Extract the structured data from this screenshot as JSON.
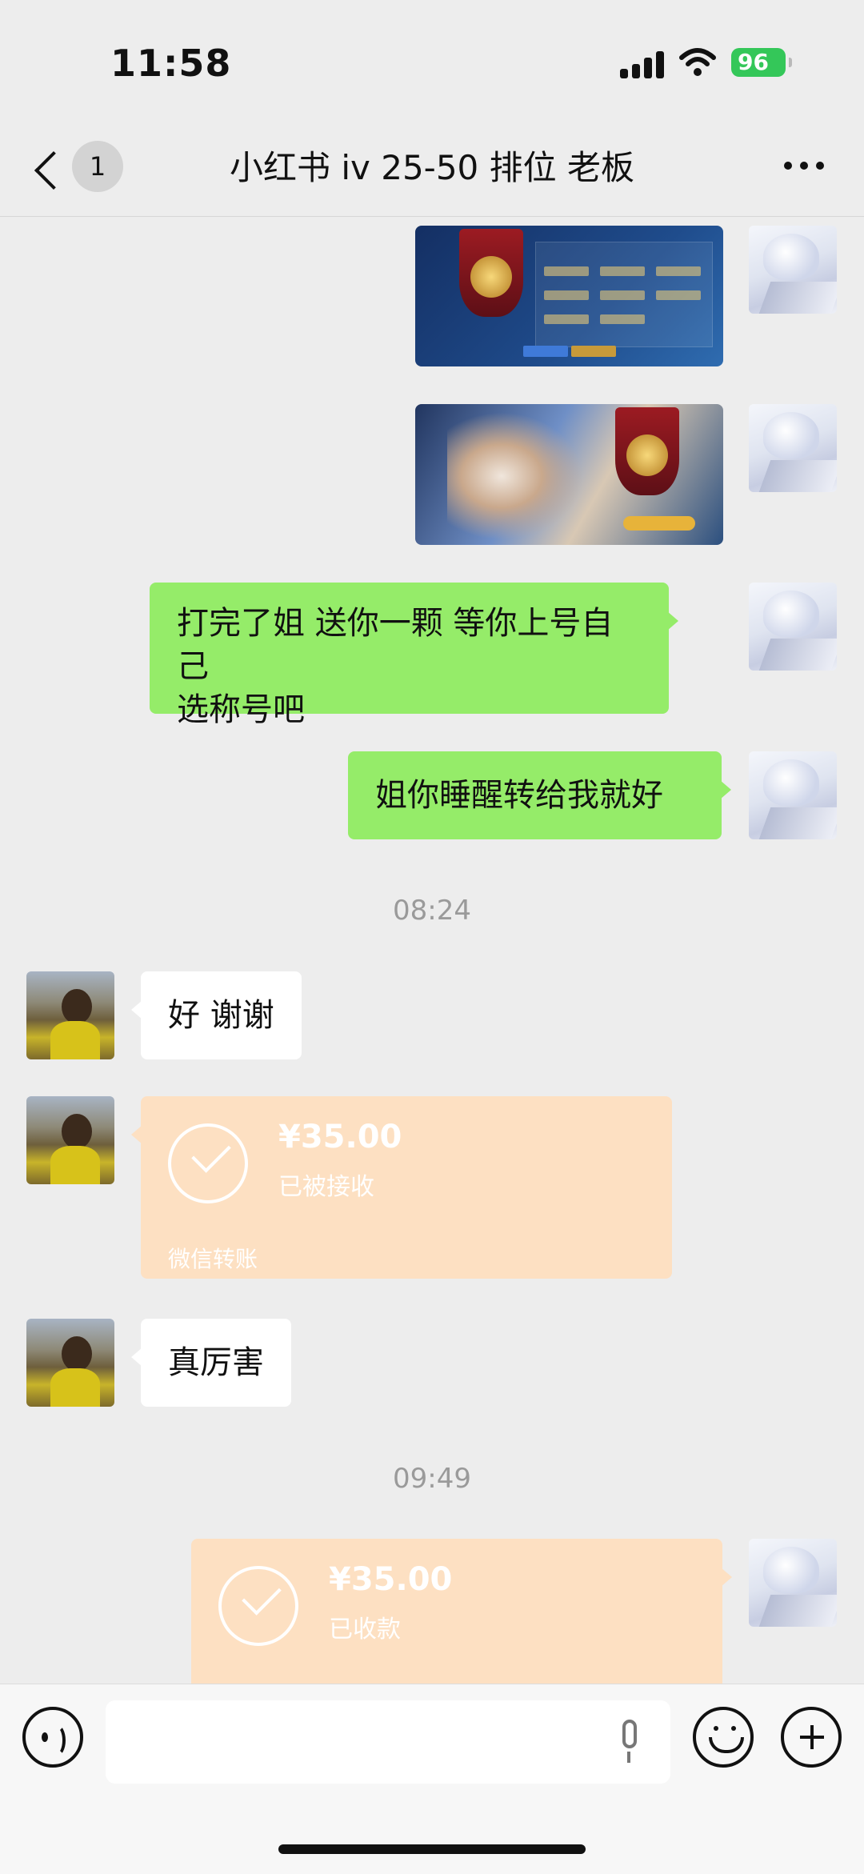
{
  "status_bar": {
    "time": "11:58",
    "battery": "96"
  },
  "nav": {
    "unread_count": "1",
    "title": "小红书 iv 25-50 排位 老板"
  },
  "messages": [
    {
      "type": "image",
      "sender": "me",
      "description": "game-rank-screenshot"
    },
    {
      "type": "image",
      "sender": "me",
      "description": "game-lobby-screenshot"
    },
    {
      "type": "text",
      "sender": "me",
      "lines": [
        "打完了姐 送你一颗 等你上号自己",
        "选称号吧"
      ]
    },
    {
      "type": "text",
      "sender": "me",
      "text": "姐你睡醒转给我就好"
    },
    {
      "type": "timestamp",
      "text": "08:24"
    },
    {
      "type": "text",
      "sender": "other",
      "text": "好 谢谢"
    },
    {
      "type": "transfer",
      "sender": "other",
      "amount": "¥35.00",
      "status": "已被接收",
      "label": "微信转账"
    },
    {
      "type": "text",
      "sender": "other",
      "text": "真厉害"
    },
    {
      "type": "timestamp",
      "text": "09:49"
    },
    {
      "type": "transfer",
      "sender": "me",
      "amount": "¥35.00",
      "status": "已收款"
    }
  ],
  "colors": {
    "my_bubble": "#95ec69",
    "other_bubble": "#ffffff",
    "transfer": "#fde0c2",
    "background": "#ededed"
  }
}
